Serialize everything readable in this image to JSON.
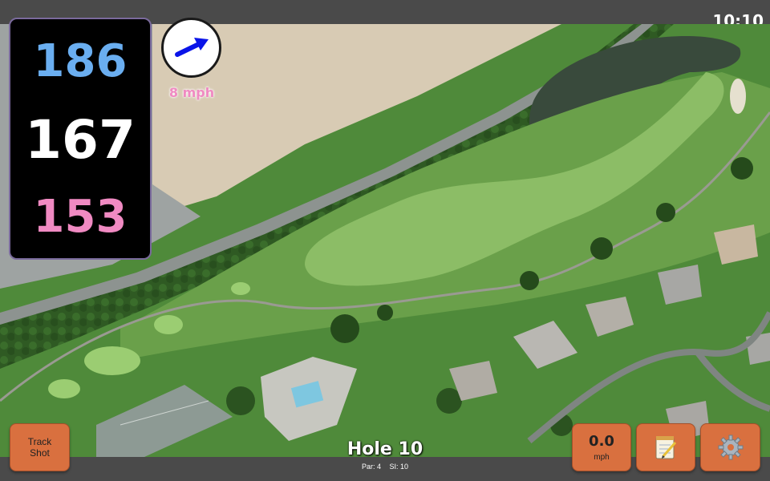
{
  "status": {
    "time": "10:10"
  },
  "distances": {
    "back": "186",
    "middle": "167",
    "front": "153"
  },
  "wind": {
    "speed_label": "8 mph",
    "arrow_icon": "wind-direction-arrow-icon",
    "arrow_color": "#0a14e8"
  },
  "buttons": {
    "track_shot_line1": "Track",
    "track_shot_line2": "Shot",
    "speed_value": "0.0",
    "speed_unit": "mph",
    "notes_icon": "notepad-icon",
    "settings_icon": "gear-icon"
  },
  "hole": {
    "title": "Hole 10",
    "par": "Par: 4",
    "si": "SI: 10"
  },
  "colors": {
    "button": "#d9703f",
    "panel": "#000000",
    "back_distance": "#6aaef0",
    "front_distance": "#f08ac2",
    "bar": "#4a4a4a"
  }
}
